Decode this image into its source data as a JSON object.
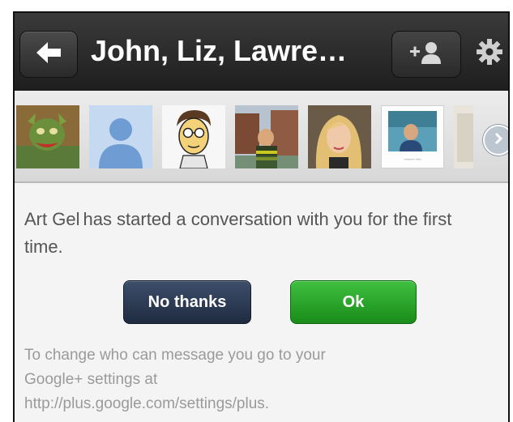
{
  "header": {
    "title": "John, Liz, Lawre…",
    "icons": {
      "back": "back-arrow-icon",
      "add_person": "add-person-icon",
      "settings": "gear-icon"
    }
  },
  "participants": [
    {
      "name": "participant-1"
    },
    {
      "name": "participant-2-default"
    },
    {
      "name": "participant-3"
    },
    {
      "name": "participant-4"
    },
    {
      "name": "participant-5"
    },
    {
      "name": "participant-6"
    },
    {
      "name": "participant-7-partial"
    }
  ],
  "message": {
    "sender": "Art Gel",
    "text": "has started a conversation with you for the first time."
  },
  "buttons": {
    "no_thanks": "No thanks",
    "ok": "Ok"
  },
  "footer": {
    "line1": "To change who can message you go to your",
    "line2": "Google+ settings at",
    "line3": "http://plus.google.com/settings/plus."
  },
  "colors": {
    "header_bg": "#1e1e1e",
    "no_thanks_bg": "#2a3854",
    "ok_bg": "#22a322"
  }
}
